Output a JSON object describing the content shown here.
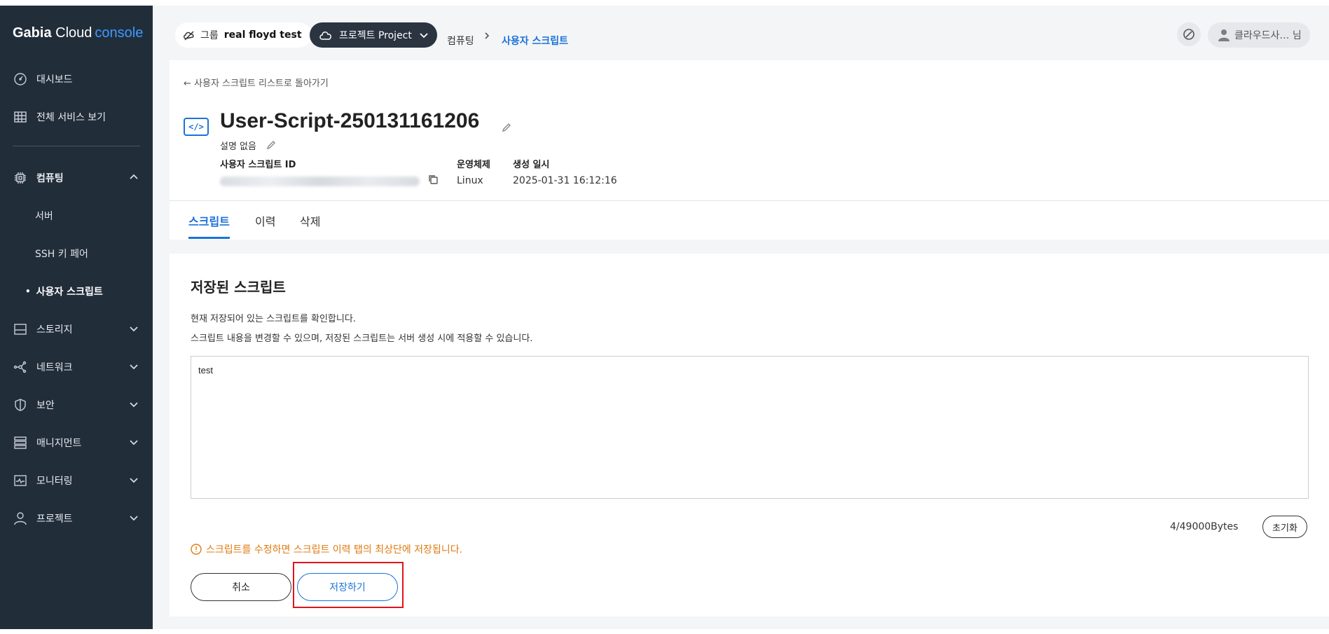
{
  "brand": {
    "name": "Gabia",
    "cloud": "Cloud",
    "console": "console"
  },
  "sidebar": {
    "items": [
      {
        "label": "대시보드",
        "icon": "dashboard-icon"
      },
      {
        "label": "전체 서비스 보기",
        "icon": "grid-icon"
      },
      {
        "label": "컴퓨팅",
        "icon": "chip-icon",
        "expanded": true,
        "children": [
          {
            "label": "서버"
          },
          {
            "label": "SSH 키 페어"
          },
          {
            "label": "사용자 스크립트",
            "active": true
          }
        ]
      },
      {
        "label": "스토리지",
        "icon": "storage-icon"
      },
      {
        "label": "네트워크",
        "icon": "network-icon"
      },
      {
        "label": "보안",
        "icon": "shield-icon"
      },
      {
        "label": "매니지먼트",
        "icon": "management-icon"
      },
      {
        "label": "모니터링",
        "icon": "monitor-icon"
      },
      {
        "label": "프로젝트",
        "icon": "person-icon"
      }
    ]
  },
  "topbar": {
    "group_label": "그룹",
    "group_name": "real floyd test",
    "project_label": "프로젝트 Project",
    "breadcrumb_parent": "컴퓨팅",
    "breadcrumb_current": "사용자 스크립트",
    "user_label": "클라우드사… 님"
  },
  "header": {
    "back_link": "← 사용자 스크립트 리스트로 돌아가기",
    "icon_text": "</>",
    "title": "User-Script-250131161206",
    "description": "설명 없음",
    "meta": {
      "id_label": "사용자 스크립트 ID",
      "os_label": "운영체제",
      "os_value": "Linux",
      "created_label": "생성 일시",
      "created_value": "2025-01-31 16:12:16"
    }
  },
  "tabs": [
    {
      "label": "스크립트",
      "active": true
    },
    {
      "label": "이력"
    },
    {
      "label": "삭제"
    }
  ],
  "content": {
    "section_title": "저장된 스크립트",
    "info_line1": "현재 저장되어 있는 스크립트를 확인합니다.",
    "info_line2": "스크립트 내용을 변경할 수 있으며, 저장된 스크립트는 서버 생성 시에 적용할 수 있습니다.",
    "script_value": "test",
    "bytes": "4/49000Bytes",
    "reset_label": "초기화",
    "warning": "스크립트를 수정하면 스크립트 이력 탭의 최상단에 저장됩니다.",
    "cancel_label": "취소",
    "save_label": "저장하기"
  },
  "colors": {
    "sidebar_bg": "#222d3a",
    "accent": "#1a72d9",
    "warning": "#e07a10",
    "highlight": "#e0141c"
  }
}
